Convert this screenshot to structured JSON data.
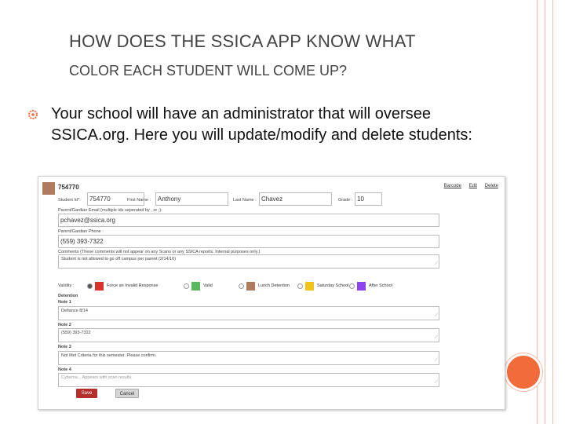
{
  "slide": {
    "title_line1": "How does the SSICA app know what",
    "title_line2": "color each student will come up?",
    "bullet": "Your school will have an administrator that will oversee SSICA.org.  Here you will update/modify and delete students:",
    "accent_color": "#f26b3a",
    "rail_color": "#f3b9a8",
    "bullet_icon": "gear-bullet-icon"
  },
  "form": {
    "student_header": "754770",
    "swatch_color": "#b07a5e",
    "links": [
      "Barcode",
      "Edit",
      "Delete"
    ],
    "student_id_label": "Student Id*:",
    "student_id_value": "754770",
    "first_name_label": "First Name :",
    "first_name_value": "Anthony",
    "last_name_label": "Last Name :",
    "last_name_value": "Chavez",
    "grade_label": "Grade :",
    "grade_value": "10",
    "email_label": "Parent/Gardian Email (multiple ids seperated by , or ;):",
    "email_value": "pchavez@ssica.org",
    "phone_label": "Parent/Gardian Phone :",
    "phone_value": "(559) 393-7322",
    "comments_label": "Comments (These comments will not appear on any Scans or any SSICA reports. Internal purposes only.)",
    "comments_value": "Student is not allowed to go off campus per parent (2/14/16)",
    "validity_label": "Validity :",
    "options": [
      {
        "label": "Force an Invalid Response",
        "color": "#d9342b",
        "checked": true
      },
      {
        "label": "Valid",
        "color": "#5cb85c",
        "checked": false
      },
      {
        "label": "Lunch Detention",
        "color": "#b07a5e",
        "checked": false
      },
      {
        "label": "Saturday School",
        "color": "#f0c419",
        "checked": false
      },
      {
        "label": "After School",
        "color": "#8e44ec",
        "checked": false
      }
    ],
    "detention_label": "Detention",
    "note1_label": "Note 1",
    "note1_value": "Defiance 8/14",
    "note2_label": "Note 2",
    "note2_value": "(559) 393-7322",
    "note3_label": "Note 3",
    "note3_value": "Not Met Criteria for this semester. Please confirm.",
    "note4_label": "Note 4",
    "note4_placeholder": "Cyberna... Appears with scan results.",
    "save_label": "Save",
    "cancel_label": "Cancel"
  }
}
